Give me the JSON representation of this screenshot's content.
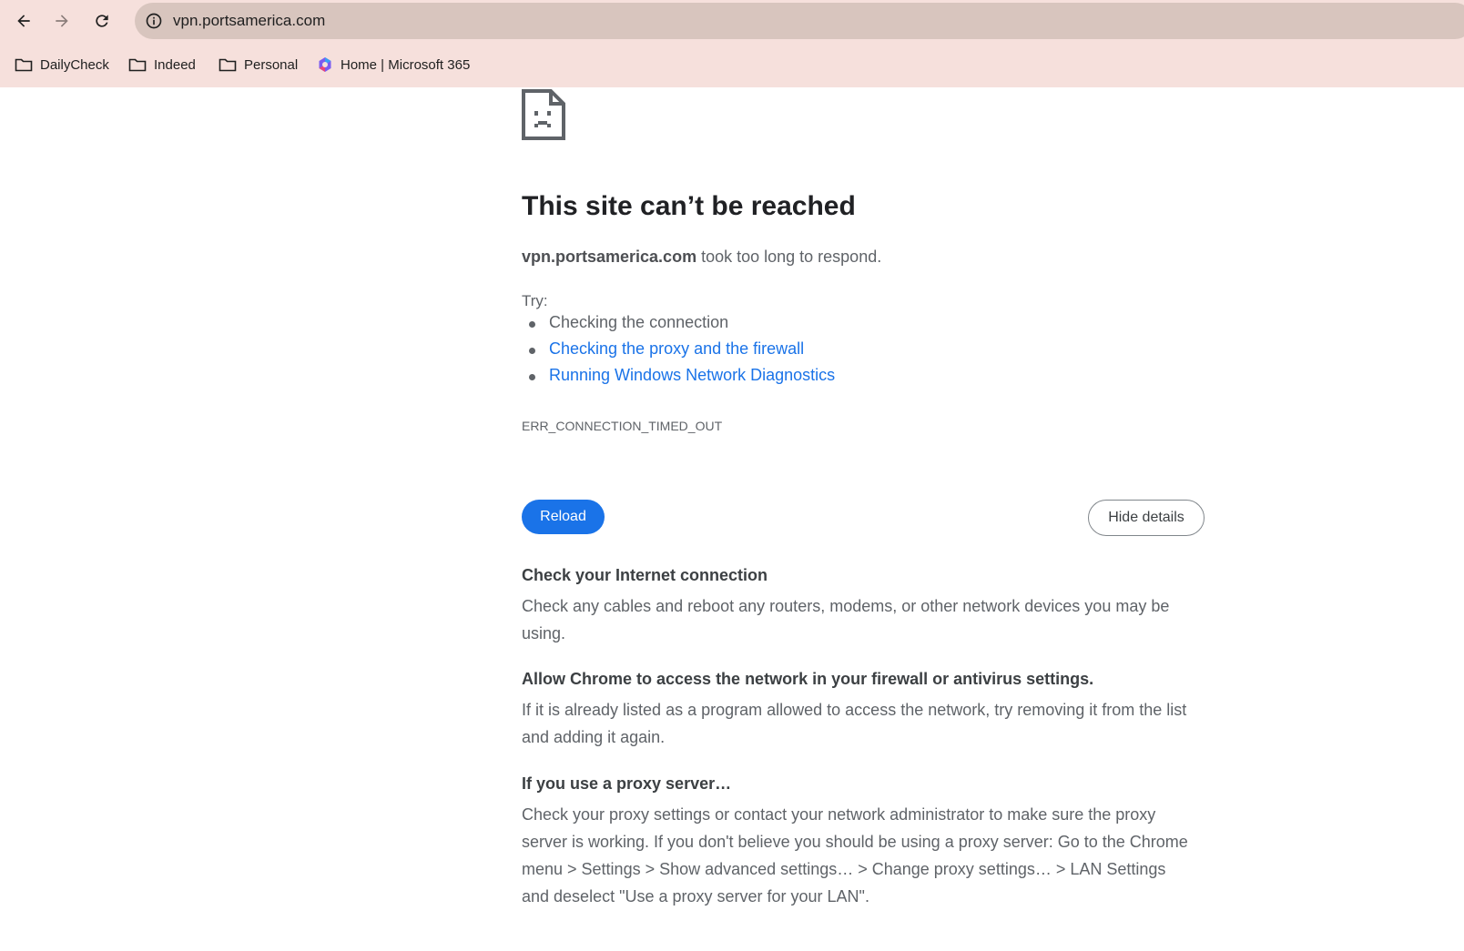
{
  "browser": {
    "url": "vpn.portsamerica.com",
    "bookmarks": [
      {
        "label": "DailyCheck",
        "icon": "folder-icon"
      },
      {
        "label": "Indeed",
        "icon": "folder-icon"
      },
      {
        "label": "Personal",
        "icon": "folder-icon"
      },
      {
        "label": "Home | Microsoft 365",
        "icon": "microsoft-365-icon"
      }
    ]
  },
  "error_page": {
    "title": "This site can’t be reached",
    "host": "vpn.portsamerica.com",
    "summary_suffix": " took too long to respond.",
    "try_label": "Try:",
    "suggestions": [
      {
        "text": "Checking the connection",
        "link": false
      },
      {
        "text": "Checking the proxy and the firewall",
        "link": true
      },
      {
        "text": "Running Windows Network Diagnostics",
        "link": true
      }
    ],
    "error_code": "ERR_CONNECTION_TIMED_OUT",
    "reload_label": "Reload",
    "hide_details_label": "Hide details",
    "details": [
      {
        "heading": "Check your Internet connection",
        "body": "Check any cables and reboot any routers, modems, or other network devices you may be using."
      },
      {
        "heading": "Allow Chrome to access the network in your firewall or antivirus settings.",
        "body": "If it is already listed as a program allowed to access the network, try removing it from the list and adding it again."
      },
      {
        "heading": "If you use a proxy server…",
        "body": "Check your proxy settings or contact your network administrator to make sure the proxy server is working. If you don't believe you should be using a proxy server: Go to the Chrome menu > Settings > Show advanced settings… > Change proxy settings… > LAN Settings and deselect \"Use a proxy server for your LAN\"."
      }
    ]
  },
  "colors": {
    "toolbar_bg": "#f6e0dc",
    "omnibox_bg": "#d8c5be",
    "link": "#1a73e8",
    "button_primary": "#1a73e8"
  }
}
